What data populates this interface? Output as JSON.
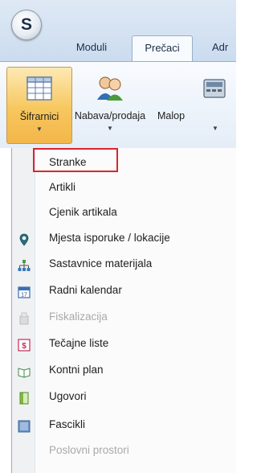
{
  "app": {
    "logo_letter": "S"
  },
  "tabs": [
    {
      "label": "Moduli"
    },
    {
      "label": "Prečaci"
    },
    {
      "label": "Adr"
    }
  ],
  "ribbon": {
    "buttons": [
      {
        "label": "Šifrarnici",
        "icon": "grid-table-icon"
      },
      {
        "label": "Nabava/prodaja",
        "icon": "people-icon"
      },
      {
        "label": "Malop",
        "icon": "register-icon"
      }
    ]
  },
  "menu": {
    "items": [
      {
        "label": "Stranke",
        "icon": "",
        "enabled": true,
        "highlighted": true
      },
      {
        "label": "Artikli",
        "icon": "",
        "enabled": true
      },
      {
        "label": "Cjenik artikala",
        "icon": "",
        "enabled": true
      },
      {
        "label": "Mjesta isporuke / lokacije",
        "icon": "location-pin-icon",
        "enabled": true
      },
      {
        "label": "Sastavnice materijala",
        "icon": "hierarchy-icon",
        "enabled": true
      },
      {
        "label": "Radni kalendar",
        "icon": "calendar-icon",
        "enabled": true
      },
      {
        "label": "Fiskalizacija",
        "icon": "fiscal-receipt-icon",
        "enabled": false
      },
      {
        "label": "Tečajne liste",
        "icon": "currency-exchange-icon",
        "enabled": true
      },
      {
        "label": "Kontni plan",
        "icon": "open-book-icon",
        "enabled": true
      },
      {
        "label": "Ugovori",
        "icon": "document-icon",
        "enabled": true
      },
      {
        "label": "Fascikli",
        "icon": "folder-icon",
        "enabled": true
      },
      {
        "label": "Poslovni prostori",
        "icon": "",
        "enabled": false
      }
    ]
  },
  "colors": {
    "highlight_box": "#d9262b",
    "selected_button": "#f7c75e",
    "ribbon_bg": "#e4edf8"
  }
}
